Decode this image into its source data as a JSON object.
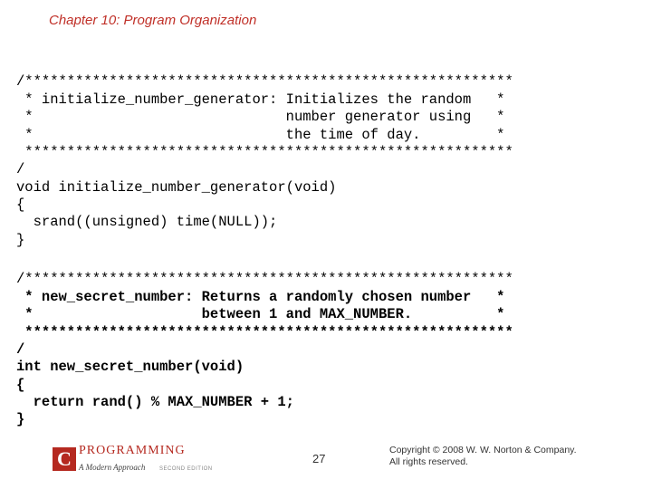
{
  "chapter_title": "Chapter 10: Program Organization",
  "code_block_1": {
    "l1": "/**********************************************************",
    "l2": " * initialize_number_generator: Initializes the random   *",
    "l3": " *                              number generator using   *",
    "l4": " *                              the time of day.         *",
    "l5": " **********************************************************",
    "l6": "/",
    "l7": "void initialize_number_generator(void)",
    "l8": "{",
    "l9": "  srand((unsigned) time(NULL));",
    "l10": "}"
  },
  "code_block_2": {
    "l1": "/**********************************************************",
    "l2": " * new_secret_number: Returns a randomly chosen number   *",
    "l3": " *                    between 1 and MAX_NUMBER.          *",
    "l4": " **********************************************************",
    "l5": "/",
    "l6": "int new_secret_number(void)",
    "l7": "{",
    "l8": "  return rand() % MAX_NUMBER + 1;",
    "l9": "}"
  },
  "logo": {
    "c": "C",
    "main": "PROGRAMMING",
    "sub": "A Modern Approach",
    "edition": "SECOND EDITION"
  },
  "page_number": "27",
  "copyright_line1": "Copyright © 2008 W. W. Norton & Company.",
  "copyright_line2": "All rights reserved."
}
